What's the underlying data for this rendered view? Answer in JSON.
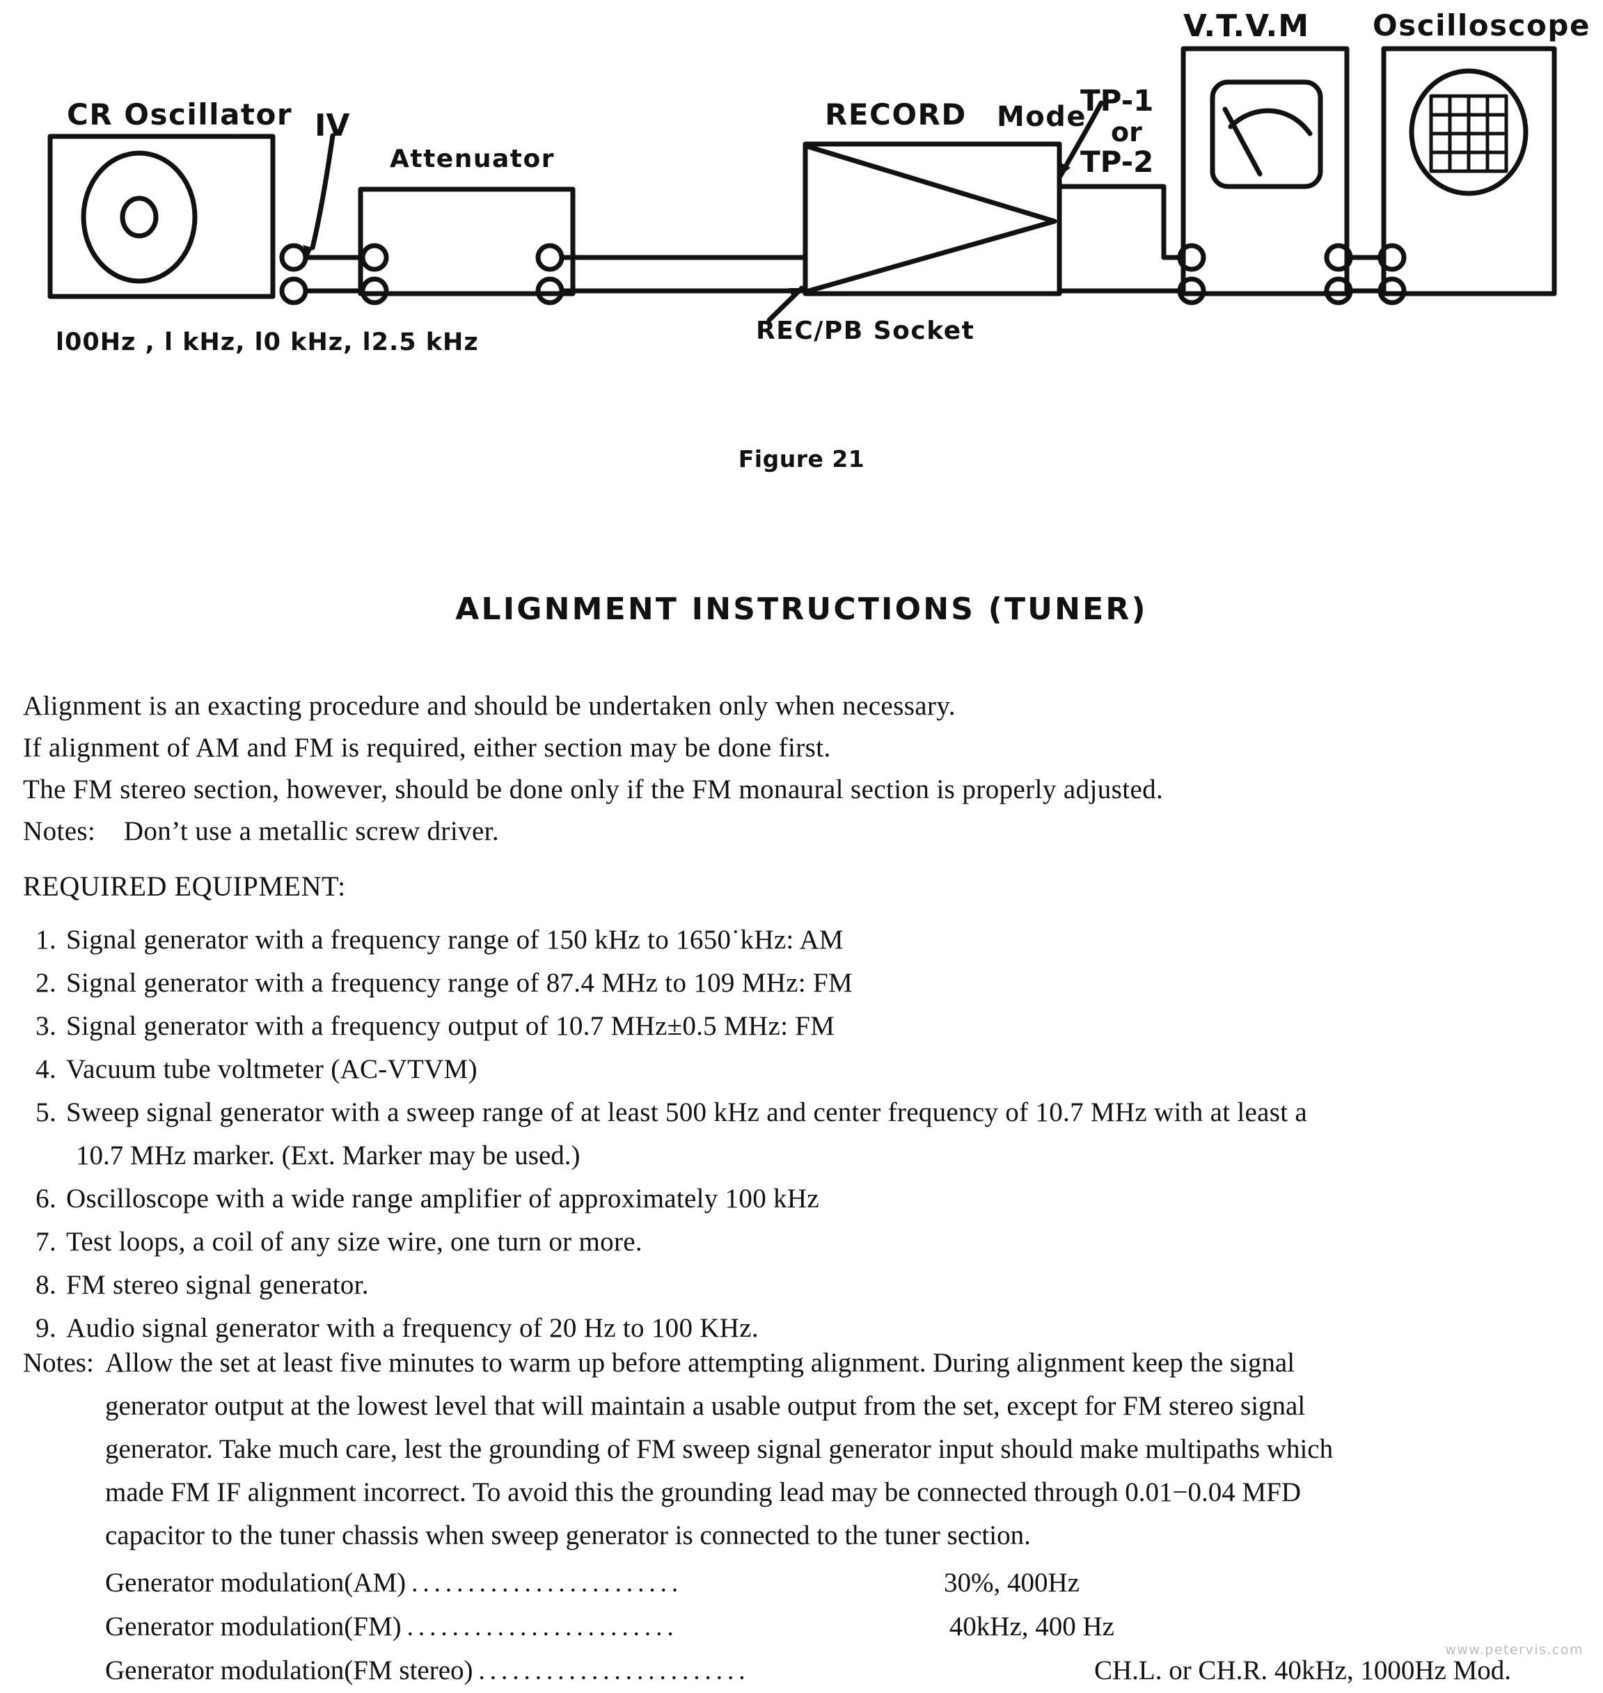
{
  "diagram": {
    "blocks": [
      {
        "key": "cr_oscillator",
        "label": "CR  Oscillator"
      },
      {
        "key": "attenuator",
        "label": "Attenuator"
      },
      {
        "key": "record_mode",
        "label": "RECORD"
      },
      {
        "key": "mode_word",
        "label": "Mode"
      },
      {
        "key": "vtvm",
        "label": "V.T.V.M"
      },
      {
        "key": "oscilloscope",
        "label": "Oscilloscope"
      }
    ],
    "labels": {
      "cr_oscillator": "CR  Oscillator",
      "attenuator": "Attenuator",
      "record": "RECORD",
      "mode": "Mode",
      "vtvm": "V.T.V.M",
      "oscilloscope": "Oscilloscope",
      "one_volt": "IV",
      "tp1": "TP-1",
      "tp_or": "or",
      "tp2": "TP-2",
      "rec_pb_socket": "REC/PB  Socket",
      "frequencies": "l00Hz , l kHz,  l0 kHz, l2.5 kHz"
    }
  },
  "figure_caption": "Figure 21",
  "heading": "ALIGNMENT  INSTRUCTIONS  (TUNER)",
  "intro": {
    "lines": [
      "Alignment is an exacting procedure and should be undertaken only when necessary.",
      "If alignment of AM and FM is required, either section may be done first.",
      "The FM stereo section, however, should be done only if the FM monaural section is properly adjusted."
    ],
    "notes_label": "Notes:",
    "notes_text": "Don’t use a metallic screw driver."
  },
  "required_equipment": {
    "heading": "REQUIRED EQUIPMENT:",
    "items": [
      {
        "num": "1.",
        "text": "Signal generator with a frequency range of 150 kHz to 1650˙kHz: AM",
        "cont": ""
      },
      {
        "num": "2.",
        "text": "Signal generator with a frequency range of 87.4 MHz to 109 MHz:  FM",
        "cont": ""
      },
      {
        "num": "3.",
        "text": "Signal generator with a frequency output of 10.7 MHz±0.5 MHz:  FM",
        "cont": ""
      },
      {
        "num": "4.",
        "text": "Vacuum tube voltmeter (AC-VTVM)",
        "cont": ""
      },
      {
        "num": "5.",
        "text": "Sweep signal generator with a sweep range of at least 500 kHz and center frequency of 10.7 MHz with at least a",
        "cont": "10.7 MHz marker. (Ext. Marker may be used.)"
      },
      {
        "num": "6.",
        "text": "Oscilloscope with a wide range amplifier of approximately 100 kHz",
        "cont": ""
      },
      {
        "num": "7.",
        "text": "Test loops, a coil of any size wire, one turn or more.",
        "cont": ""
      },
      {
        "num": "8.",
        "text": "FM stereo signal generator.",
        "cont": ""
      },
      {
        "num": "9.",
        "text": "Audio signal generator with a frequency of 20 Hz to 100 KHz.",
        "cont": ""
      }
    ]
  },
  "final_notes": {
    "label": "Notes:",
    "lines": [
      "Allow the set at least five minutes to warm up before attempting alignment.  During alignment keep the signal",
      "generator output at the lowest level that will maintain a usable output from the set, except for FM stereo signal",
      "generator.   Take much care, lest the grounding of FM sweep signal generator input should make multipaths which",
      "made FM IF alignment incorrect.   To avoid this the grounding lead may be connected through 0.01−0.04 MFD",
      "capacitor to the tuner chassis when sweep generator is connected to the tuner section."
    ],
    "modulation": [
      {
        "name": "Generator modulation(AM)",
        "dots": "........................",
        "value": "30%, 400Hz",
        "w": "w1"
      },
      {
        "name": "Generator modulation(FM)",
        "dots": "........................",
        "value": "40kHz, 400 Hz",
        "w": "w2"
      },
      {
        "name": "Generator modulation(FM stereo)",
        "dots": "........................",
        "value": "CH.L. or CH.R. 40kHz, 1000Hz Mod.",
        "w": "w3"
      }
    ]
  },
  "watermark": "www.petervis.com"
}
